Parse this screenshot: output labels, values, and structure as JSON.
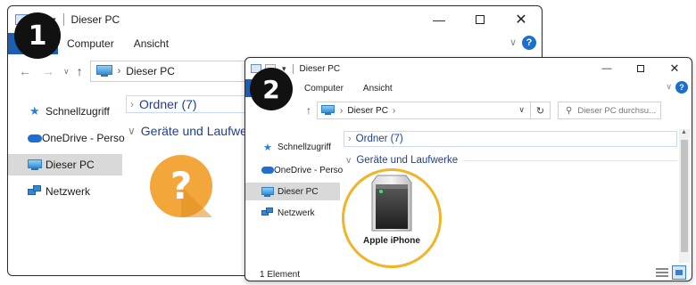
{
  "colors": {
    "accent": "#1a5fb4",
    "group_header": "#1f3f8f",
    "highlight_ring": "#f0b429",
    "question": "#f3a73b",
    "badge": "#111111"
  },
  "window1": {
    "title": "Dieser PC",
    "ribbon": {
      "tabs": [
        "Computer",
        "Ansicht"
      ],
      "help": "?"
    },
    "address": {
      "location": "Dieser PC"
    },
    "sidebar": [
      {
        "label": "Schnellzugriff",
        "icon": "star-icon"
      },
      {
        "label": "OneDrive - Perso",
        "icon": "cloud-icon"
      },
      {
        "label": "Dieser PC",
        "icon": "pc-icon",
        "selected": true
      },
      {
        "label": "Netzwerk",
        "icon": "network-icon"
      }
    ],
    "groups": {
      "folders": "Ordner (7)",
      "devices": "Geräte und Laufwerke"
    },
    "badge": "1",
    "question_glyph": "?"
  },
  "window2": {
    "title": "Dieser PC",
    "ribbon": {
      "tabs": [
        "Computer",
        "Ansicht"
      ],
      "help": "?"
    },
    "address": {
      "location": "Dieser PC",
      "search_placeholder": "Dieser PC durchsu..."
    },
    "sidebar": [
      {
        "label": "Schnellzugriff",
        "icon": "star-icon"
      },
      {
        "label": "OneDrive - Perso",
        "icon": "cloud-icon"
      },
      {
        "label": "Dieser PC",
        "icon": "pc-icon",
        "selected": true
      },
      {
        "label": "Netzwerk",
        "icon": "network-icon"
      }
    ],
    "groups": {
      "folders": "Ordner (7)",
      "devices": "Geräte und Laufwerke"
    },
    "device": {
      "label": "Apple iPhone",
      "icon": "device-drive-icon"
    },
    "status": "1 Element",
    "badge": "2"
  }
}
